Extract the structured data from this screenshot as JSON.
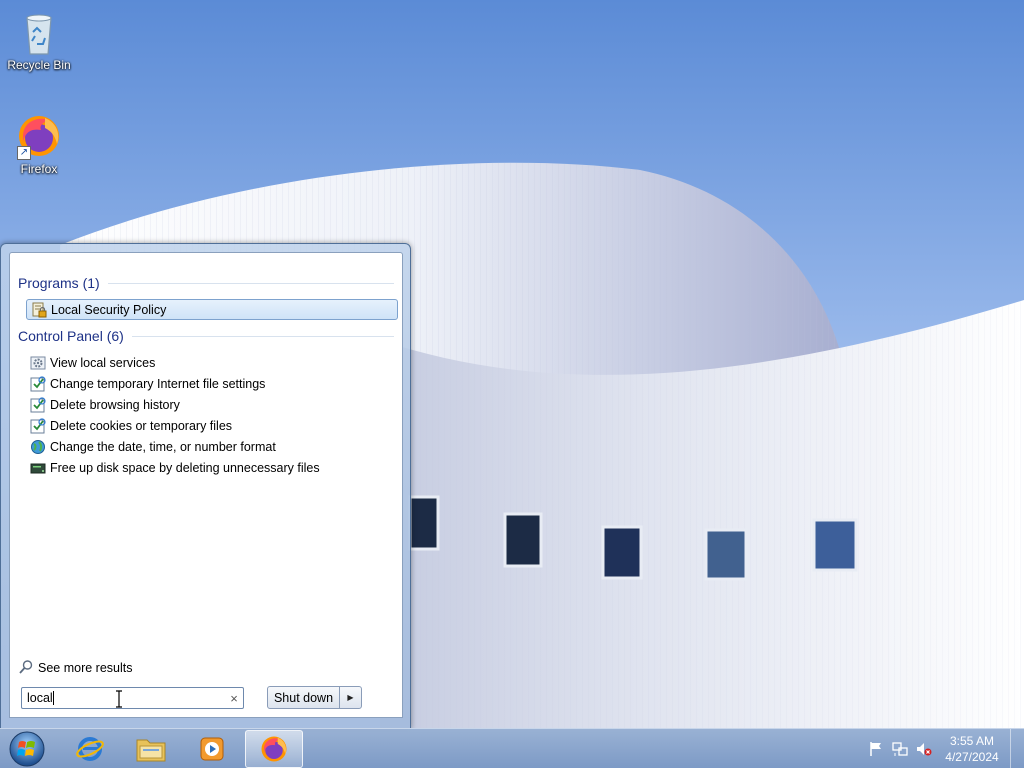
{
  "desktop": {
    "icons": [
      {
        "label": "Recycle Bin",
        "icon": "recycle-bin-icon"
      },
      {
        "label": "Firefox",
        "icon": "firefox-icon"
      }
    ]
  },
  "start_menu": {
    "programs_heading": "Programs (1)",
    "programs": [
      {
        "label": "Local Security Policy",
        "icon": "security-policy-icon",
        "selected": true
      }
    ],
    "control_panel_heading": "Control Panel (6)",
    "control_panel": [
      {
        "label": "View local services",
        "icon": "services-gear-icon"
      },
      {
        "label": "Change temporary Internet file settings",
        "icon": "internet-options-icon"
      },
      {
        "label": "Delete browsing history",
        "icon": "internet-options-icon"
      },
      {
        "label": "Delete cookies or temporary files",
        "icon": "internet-options-icon"
      },
      {
        "label": "Change the date, time, or number format",
        "icon": "region-globe-icon"
      },
      {
        "label": "Free up disk space by deleting unnecessary files",
        "icon": "disk-cleanup-icon"
      }
    ],
    "see_more": "See more results",
    "search": {
      "value": "local",
      "clear_glyph": "×"
    },
    "shutdown_label": "Shut down",
    "shutdown_arrow_glyph": "▶"
  },
  "taskbar": {
    "pinned": [
      {
        "name": "internet-explorer",
        "icon": "internet-explorer-icon"
      },
      {
        "name": "windows-explorer",
        "icon": "folder-icon"
      },
      {
        "name": "media-player",
        "icon": "media-player-icon"
      },
      {
        "name": "firefox",
        "icon": "firefox-icon",
        "active": true
      }
    ],
    "tray": {
      "icons": [
        "action-center-flag-icon",
        "network-icon",
        "volume-muted-icon"
      ],
      "time": "3:55 AM",
      "date": "4/27/2024"
    }
  },
  "colors": {
    "heading": "#1e3287",
    "sky": "#8db0ea",
    "taskbar": "#7896c3"
  }
}
